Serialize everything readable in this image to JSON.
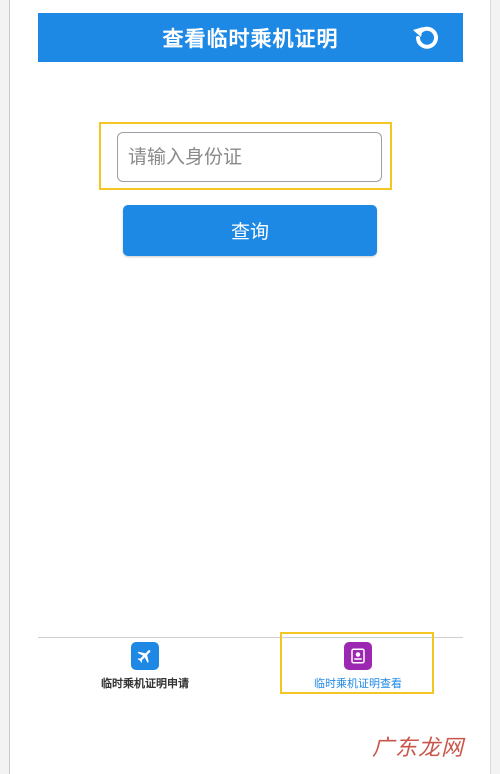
{
  "header": {
    "title": "查看临时乘机证明",
    "refresh_icon": "refresh-icon"
  },
  "form": {
    "id_placeholder": "请输入身份证",
    "id_value": "",
    "query_label": "查询"
  },
  "tabbar": {
    "items": [
      {
        "label": "临时乘机证明申请",
        "icon": "airplane-icon",
        "color": "#1e88e5",
        "active": false
      },
      {
        "label": "临时乘机证明查看",
        "icon": "certificate-icon",
        "color": "#9c27b0",
        "active": true
      }
    ]
  },
  "watermark": "广东龙网",
  "colors": {
    "primary": "#1e88e5",
    "highlight": "#f3c623",
    "accent_purple": "#9c27b0"
  }
}
